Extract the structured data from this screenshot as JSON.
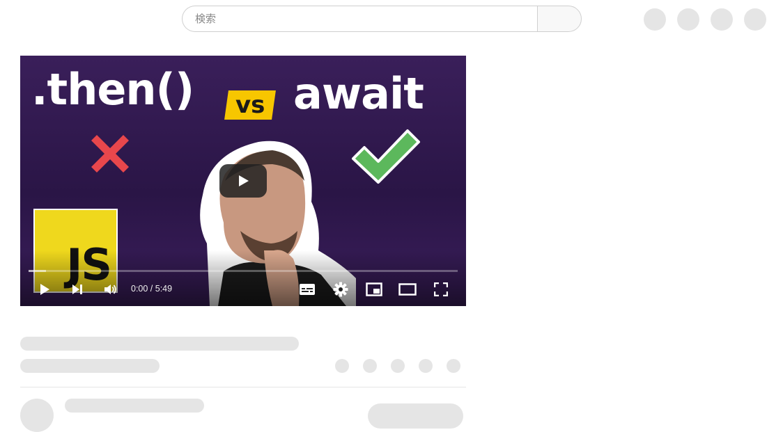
{
  "search": {
    "placeholder": "検索"
  },
  "thumbnail": {
    "title_left": ".then()",
    "vs_label": "vs",
    "title_right": "await",
    "js_badge": "JS"
  },
  "player": {
    "time": "0:00 / 5:49",
    "progress_loaded_fraction": 0.04
  },
  "icons": {
    "play": "play-icon",
    "next": "next-icon",
    "volume": "volume-icon",
    "subtitles": "subtitles-icon",
    "settings": "gear-icon",
    "miniplayer": "miniplayer-icon",
    "theater": "theater-mode-icon",
    "fullscreen": "fullscreen-icon"
  },
  "colors": {
    "accent_yellow": "#f7c600",
    "js_yellow": "#efd81d",
    "cross_red": "#e8474c",
    "check_green": "#5cb85c",
    "skeleton": "#e5e5e5"
  }
}
